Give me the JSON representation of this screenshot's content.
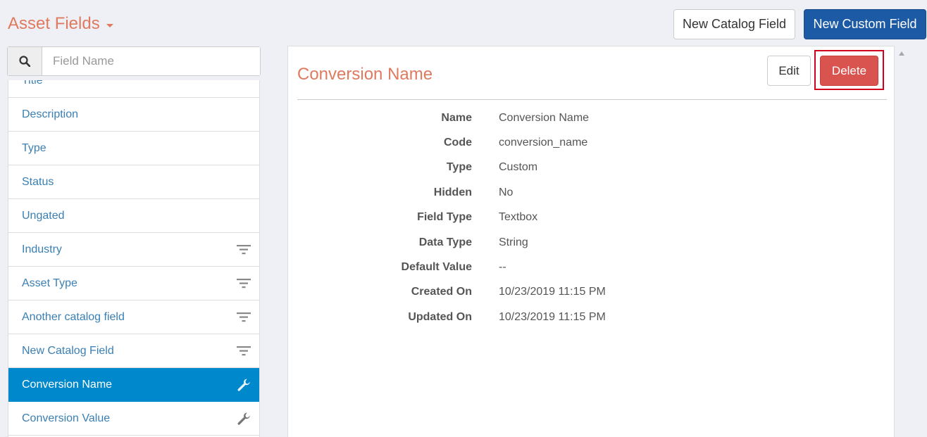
{
  "header": {
    "title": "Asset Fields",
    "new_catalog_field_label": "New Catalog Field",
    "new_custom_field_label": "New Custom Field"
  },
  "search": {
    "placeholder": "Field Name",
    "value": "",
    "icon": "search-icon"
  },
  "field_list": {
    "items": [
      {
        "label": "Title",
        "icon": ""
      },
      {
        "label": "Description",
        "icon": ""
      },
      {
        "label": "Type",
        "icon": ""
      },
      {
        "label": "Status",
        "icon": ""
      },
      {
        "label": "Ungated",
        "icon": ""
      },
      {
        "label": "Industry",
        "icon": "filter-icon"
      },
      {
        "label": "Asset Type",
        "icon": "filter-icon"
      },
      {
        "label": "Another catalog field",
        "icon": "filter-icon"
      },
      {
        "label": "New Catalog Field",
        "icon": "filter-icon"
      },
      {
        "label": "Conversion Name",
        "icon": "wrench-icon",
        "selected": true
      },
      {
        "label": "Conversion Value",
        "icon": "wrench-icon"
      }
    ]
  },
  "detail": {
    "title": "Conversion Name",
    "edit_label": "Edit",
    "delete_label": "Delete",
    "properties": [
      {
        "label": "Name",
        "value": "Conversion Name"
      },
      {
        "label": "Code",
        "value": "conversion_name"
      },
      {
        "label": "Type",
        "value": "Custom"
      },
      {
        "label": "Hidden",
        "value": "No"
      },
      {
        "label": "Field Type",
        "value": "Textbox"
      },
      {
        "label": "Data Type",
        "value": "String"
      },
      {
        "label": "Default Value",
        "value": "--"
      },
      {
        "label": "Created On",
        "value": "10/23/2019 11:15 PM"
      },
      {
        "label": "Updated On",
        "value": "10/23/2019 11:15 PM"
      }
    ]
  },
  "colors": {
    "accent_title": "#e07a5f",
    "primary_button": "#1d5aa6",
    "danger_button": "#d9534f",
    "selected_item": "#0088cc",
    "link_text": "#3a7fb3",
    "highlight_border": "#d0021b"
  }
}
